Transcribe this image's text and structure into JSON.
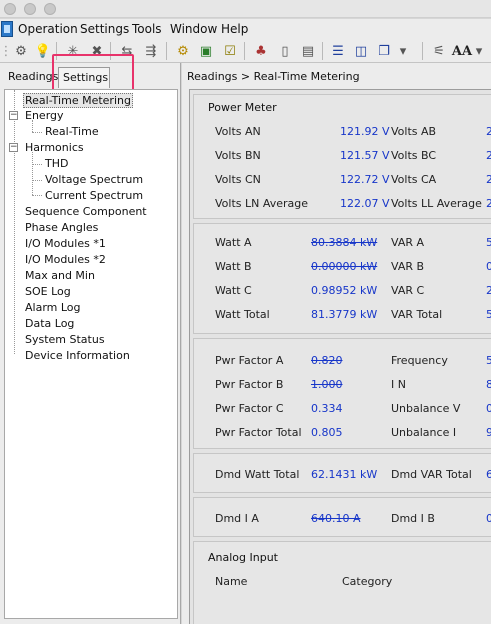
{
  "menubar": {
    "items": [
      "Operation",
      "Settings",
      "Tools",
      "Window",
      "Help"
    ]
  },
  "toolbar": {
    "icons": [
      "gear-icon",
      "bulb-icon",
      "star-burst-icon",
      "x-burst-icon",
      "transfer-icon",
      "transfer-settings-icon",
      "cog-settings-icon",
      "monitor-icon",
      "checklist-icon",
      "tree-network-icon",
      "device-icon",
      "device-list-icon",
      "stack-h-icon",
      "split-panel-icon",
      "cascade-windows-icon",
      "settings-list-icon",
      "font-size-icon"
    ],
    "font_label": "AA"
  },
  "left_panel": {
    "tabs": [
      "Readings",
      "Settings"
    ],
    "tree": [
      {
        "label": "Real-Time Metering",
        "level": 1,
        "selected": true
      },
      {
        "label": "Energy",
        "level": 0,
        "expanded": true
      },
      {
        "label": "Real-Time",
        "level": 2
      },
      {
        "label": "Harmonics",
        "level": 0,
        "expanded": true
      },
      {
        "label": "THD",
        "level": 2
      },
      {
        "label": "Voltage Spectrum",
        "level": 2
      },
      {
        "label": "Current Spectrum",
        "level": 2
      },
      {
        "label": "Sequence Component",
        "level": 1
      },
      {
        "label": "Phase Angles",
        "level": 1
      },
      {
        "label": "I/O Modules *1",
        "level": 1
      },
      {
        "label": "I/O Modules *2",
        "level": 1
      },
      {
        "label": "Max and Min",
        "level": 1
      },
      {
        "label": "SOE Log",
        "level": 1
      },
      {
        "label": "Alarm Log",
        "level": 1
      },
      {
        "label": "Data Log",
        "level": 1
      },
      {
        "label": "System Status",
        "level": 1
      },
      {
        "label": "Device Information",
        "level": 1
      }
    ]
  },
  "right_panel": {
    "breadcrumb": "Readings > Real-Time Metering",
    "power_meter_title": "Power Meter",
    "voltage": [
      {
        "label": "Volts AN",
        "value": "121.92 V",
        "label2": "Volts AB",
        "value2": "2"
      },
      {
        "label": "Volts BN",
        "value": "121.57 V",
        "label2": "Volts BC",
        "value2": "2"
      },
      {
        "label": "Volts CN",
        "value": "122.72 V",
        "label2": "Volts CA",
        "value2": "2"
      },
      {
        "label": "Volts LN Average",
        "value": "122.07 V",
        "label2": "Volts LL Average",
        "value2": "2"
      }
    ],
    "power": [
      {
        "label": "Watt A",
        "value": "80.3884 kW",
        "label2": "VAR A",
        "value2": "5"
      },
      {
        "label": "Watt B",
        "value": "0.00000 kW",
        "label2": "VAR B",
        "value2": "0"
      },
      {
        "label": "Watt C",
        "value": "0.98952 kW",
        "label2": "VAR C",
        "value2": "2"
      },
      {
        "label": "Watt Total",
        "value": "81.3779 kW",
        "label2": "VAR Total",
        "value2": "5"
      }
    ],
    "factor": [
      {
        "label": "Pwr Factor A",
        "value": "0.820",
        "label2": "Frequency",
        "value2": "5"
      },
      {
        "label": "Pwr Factor B",
        "value": "1.000",
        "label2": "I N",
        "value2": "8"
      },
      {
        "label": "Pwr Factor C",
        "value": "0.334",
        "label2": "Unbalance V",
        "value2": "0"
      },
      {
        "label": "Pwr Factor Total",
        "value": "0.805",
        "label2": "Unbalance I",
        "value2": "9"
      }
    ],
    "demand_power": {
      "label": "Dmd Watt Total",
      "value": "62.1431 kW",
      "label2": "Dmd VAR Total",
      "value2": "6"
    },
    "demand_current": {
      "label": "Dmd I A",
      "value": "640.10 A",
      "label2": "Dmd I B",
      "value2": "0"
    },
    "analog": {
      "title": "Analog Input",
      "col1": "Name",
      "col2": "Category"
    }
  }
}
